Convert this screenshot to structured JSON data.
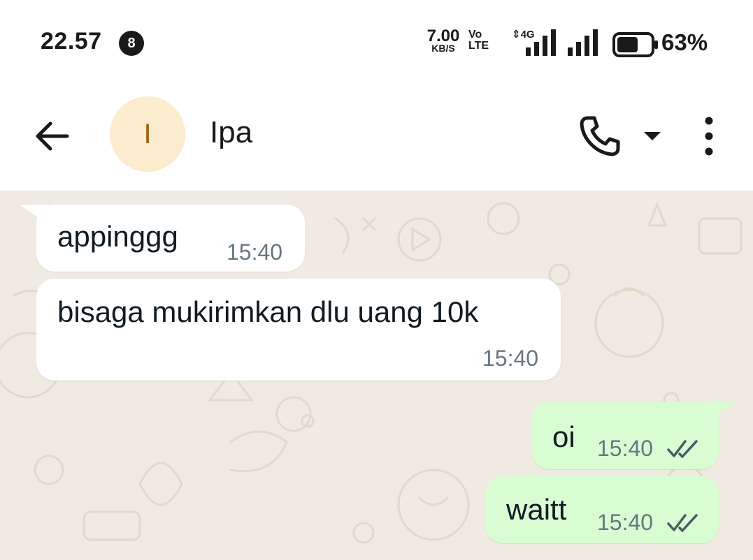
{
  "status_bar": {
    "time": "22.57",
    "notification_count": "8",
    "net_speed_value": "7.00",
    "net_speed_unit": "KB/S",
    "volte_top": "Vo",
    "volte_bottom": "LTE",
    "network_type": "4G",
    "battery_percent": "63%",
    "battery_level": 0.63
  },
  "header": {
    "avatar_initial": "I",
    "contact_name": "Ipa",
    "icons": [
      "back-arrow-icon",
      "phone-icon",
      "dropdown-caret-icon",
      "more-vert-icon"
    ]
  },
  "messages": [
    {
      "direction": "incoming",
      "text": "appinggg",
      "time": "15:40"
    },
    {
      "direction": "incoming",
      "text": "bisaga mukirimkan dlu uang 10k",
      "time": "15:40"
    },
    {
      "direction": "outgoing",
      "text": "oi",
      "time": "15:40",
      "status": "read-ticks"
    },
    {
      "direction": "outgoing",
      "text": "waitt",
      "time": "15:40",
      "status": "read-ticks"
    }
  ],
  "colors": {
    "chat_background": "#efeae2",
    "incoming_bubble": "#ffffff",
    "outgoing_bubble": "#d9fdd3",
    "avatar_background": "#fbeccd",
    "avatar_text": "#9a6416",
    "timestamp": "#667781"
  }
}
